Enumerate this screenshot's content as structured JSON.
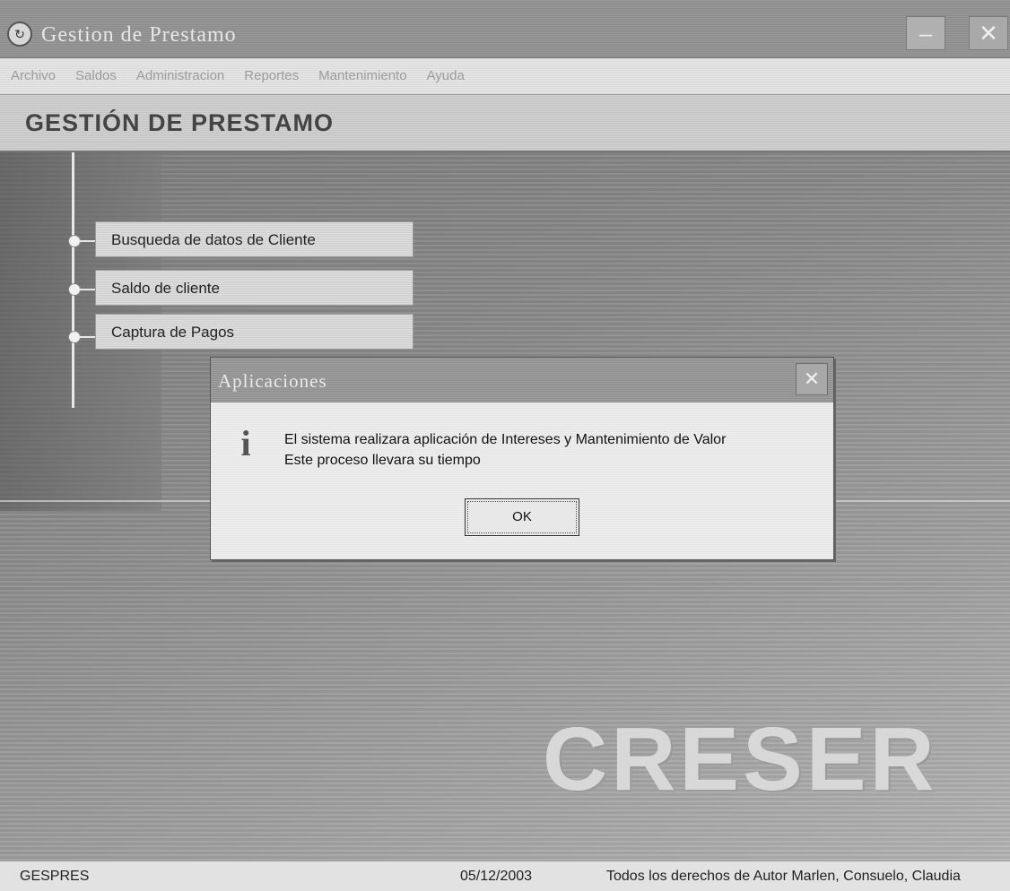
{
  "window": {
    "title": "Gestion de Prestamo",
    "minimize_glyph": "–",
    "close_glyph": "✕"
  },
  "menubar": {
    "items": [
      "Archivo",
      "Saldos",
      "Administracion",
      "Reportes",
      "Mantenimiento",
      "Ayuda"
    ]
  },
  "header": {
    "title": "GESTIÓN DE PRESTAMO"
  },
  "main": {
    "menu_items": [
      "Busqueda de datos de Cliente",
      "Saldo de cliente",
      "Captura de Pagos"
    ],
    "brand": "CRESER"
  },
  "dialog": {
    "title": "Aplicaciones",
    "close_glyph": "✕",
    "icon": "info-icon",
    "icon_glyph": "i",
    "message_line1": "El sistema realizara aplicación de Intereses y Mantenimiento de Valor",
    "message_line2": "Este proceso llevara su tiempo",
    "ok_label": "OK"
  },
  "statusbar": {
    "app_code": "GESPRES",
    "date": "05/12/2003",
    "copyright": "Todos los derechos de Autor Marlen, Consuelo, Claudia"
  }
}
